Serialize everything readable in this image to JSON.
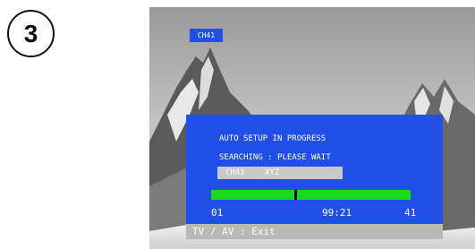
{
  "step": {
    "number": "3"
  },
  "screen": {
    "channel_badge": "CH41",
    "panel": {
      "title": "AUTO SETUP IN PROGRESS",
      "status": "SEARCHING : PLEASE WAIT",
      "channel_field": {
        "channel": "CH41",
        "name": "XYZ"
      },
      "progress": {
        "start_label": "01",
        "current_label": "99:21",
        "end_label": "41",
        "fraction": 0.42
      }
    },
    "exit_hint": "TV / AV : Exit"
  },
  "colors": {
    "osd_blue": "#1f4fe6",
    "progress_green": "#19d919",
    "field_gray": "#c9c9c9"
  },
  "icons": {
    "step_marker": "circled-number"
  }
}
